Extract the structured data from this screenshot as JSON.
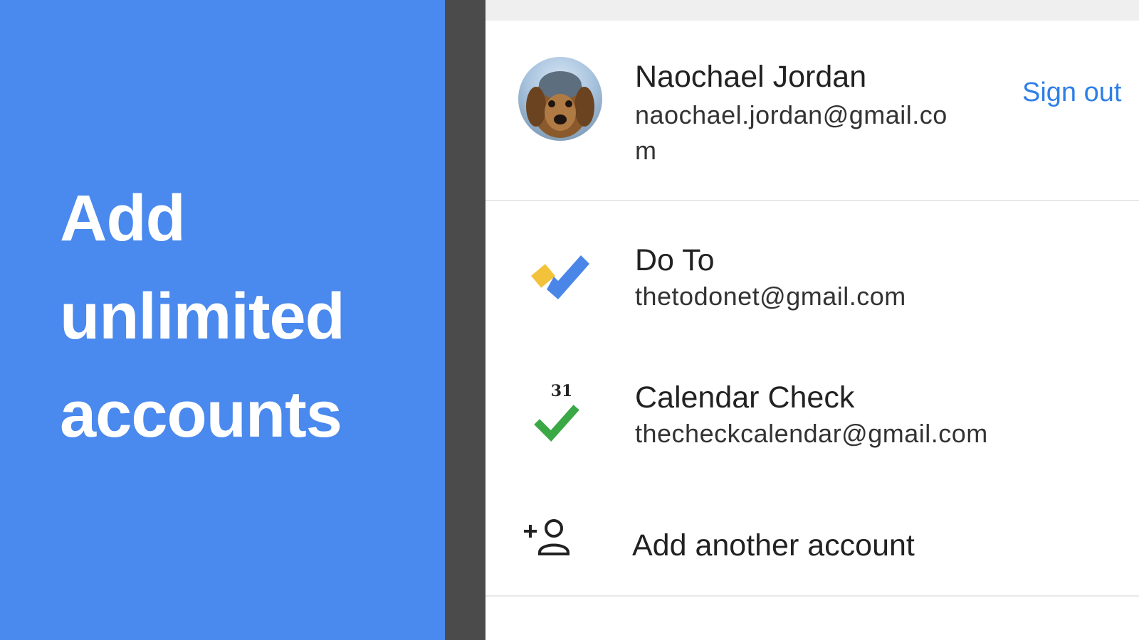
{
  "promo": {
    "lines": [
      "Add",
      "unlimited",
      "accounts"
    ]
  },
  "primary_account": {
    "name": "Naochael Jordan",
    "email": "naochael.jordan@gmail.com",
    "sign_out_label": "Sign out"
  },
  "accounts": [
    {
      "name": "Do To",
      "email": "thetodonet@gmail.com",
      "icon": "todo-check-icon"
    },
    {
      "name": "Calendar Check",
      "email": "thecheckcalendar@gmail.com",
      "icon": "calendar-check-icon",
      "icon_text": "31"
    }
  ],
  "add_account": {
    "label": "Add another account",
    "icon": "add-person-icon"
  },
  "colors": {
    "promo_bg": "#4a89ee",
    "link": "#2e7fe8",
    "todo_blue": "#4a86e8",
    "todo_yellow": "#f2c23a",
    "check_green": "#3aa845"
  }
}
